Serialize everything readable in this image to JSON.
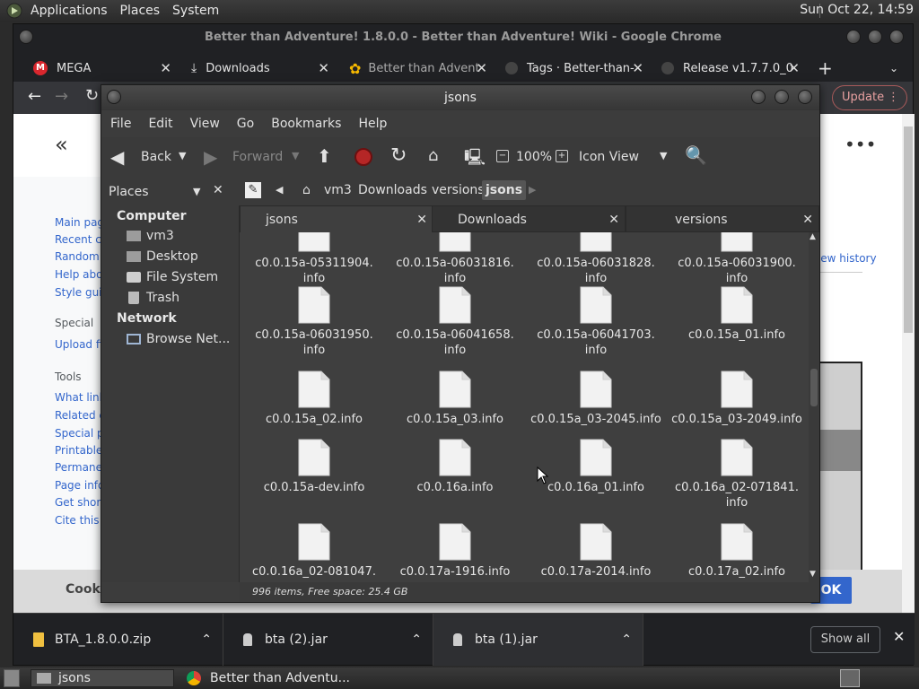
{
  "top_panel": {
    "menus": [
      "Applications",
      "Places",
      "System"
    ],
    "clock": "Sun Oct 22, 14:59"
  },
  "chrome": {
    "window_title": "Better than Adventure! 1.8.0.0 - Better than Adventure! Wiki - Google Chrome",
    "tabs": [
      {
        "label": "MEGA",
        "icon": "mega-icon",
        "accent": "#d9272e"
      },
      {
        "label": "Downloads",
        "icon": "download-icon"
      },
      {
        "label": "Better than Advent",
        "icon": "flower-favicon",
        "accent": "#f5b800"
      },
      {
        "label": "Tags · Better-than-",
        "icon": "github-icon"
      },
      {
        "label": "Release v1.7.7.0_0",
        "icon": "github-icon"
      }
    ],
    "new_tab": "+",
    "update_button": "Update",
    "wiki": {
      "back_chevron": "«",
      "nav_links": [
        "Main page",
        "Recent changes",
        "Random page",
        "Help about MediaWiki",
        "Style guide"
      ],
      "special_heading": "Special",
      "special_links": [
        "Upload file"
      ],
      "tools_heading": "Tools",
      "tools_links": [
        "What links here",
        "Related changes",
        "Special pages",
        "Printable version",
        "Permanent link",
        "Page information",
        "Get shortened URL",
        "Cite this page"
      ],
      "view_history": "View history",
      "cookie_text": "Cookies",
      "ok_button": "OK"
    },
    "downloads": [
      {
        "name": "BTA_1.8.0.0.zip",
        "icon": "zip-icon"
      },
      {
        "name": "bta (2).jar",
        "icon": "jar-icon"
      },
      {
        "name": "bta (1).jar",
        "icon": "jar-icon"
      }
    ],
    "show_all": "Show all"
  },
  "file_manager": {
    "title": "jsons",
    "menu": [
      "File",
      "Edit",
      "View",
      "Go",
      "Bookmarks",
      "Help"
    ],
    "toolbar": {
      "back": "Back",
      "forward": "Forward",
      "zoom": "100%",
      "view_mode": "Icon View"
    },
    "places_label": "Places",
    "breadcrumb": [
      "vm3",
      "Downloads",
      "versions",
      "jsons"
    ],
    "sidebar": {
      "computer_heading": "Computer",
      "computer_items": [
        {
          "label": "vm3",
          "icon": "home-folder-icon"
        },
        {
          "label": "Desktop",
          "icon": "desktop-folder-icon"
        },
        {
          "label": "File System",
          "icon": "drive-icon"
        },
        {
          "label": "Trash",
          "icon": "trash-icon"
        }
      ],
      "network_heading": "Network",
      "network_items": [
        {
          "label": "Browse Net...",
          "icon": "network-icon"
        }
      ]
    },
    "tabs": [
      "jsons",
      "Downloads",
      "versions"
    ],
    "files": [
      [
        "c0.0.15a-05311904.",
        "info"
      ],
      [
        "c0.0.15a-06031816.",
        "info"
      ],
      [
        "c0.0.15a-06031828.",
        "info"
      ],
      [
        "c0.0.15a-06031900.",
        "info"
      ],
      [
        "c0.0.15a-06031950.",
        "info"
      ],
      [
        "c0.0.15a-06041658.",
        "info"
      ],
      [
        "c0.0.15a-06041703.",
        "info"
      ],
      [
        "c0.0.15a_01.info",
        ""
      ],
      [
        "c0.0.15a_02.info",
        ""
      ],
      [
        "c0.0.15a_03.info",
        ""
      ],
      [
        "c0.0.15a_03-2045.info",
        ""
      ],
      [
        "c0.0.15a_03-2049.info",
        ""
      ],
      [
        "c0.0.15a-dev.info",
        ""
      ],
      [
        "c0.0.16a.info",
        ""
      ],
      [
        "c0.0.16a_01.info",
        ""
      ],
      [
        "c0.0.16a_02-071841.",
        "info"
      ],
      [
        "c0.0.16a_02-081047.",
        ""
      ],
      [
        "c0.0.17a-1916.info",
        ""
      ],
      [
        "c0.0.17a-2014.info",
        ""
      ],
      [
        "c0.0.17a_02.info",
        ""
      ]
    ],
    "status": "996 items, Free space: 25.4 GB"
  },
  "taskbar": {
    "items": [
      {
        "label": "jsons",
        "icon": "folder-icon"
      },
      {
        "label": "Better than Adventu...",
        "icon": "chrome-icon"
      }
    ]
  }
}
